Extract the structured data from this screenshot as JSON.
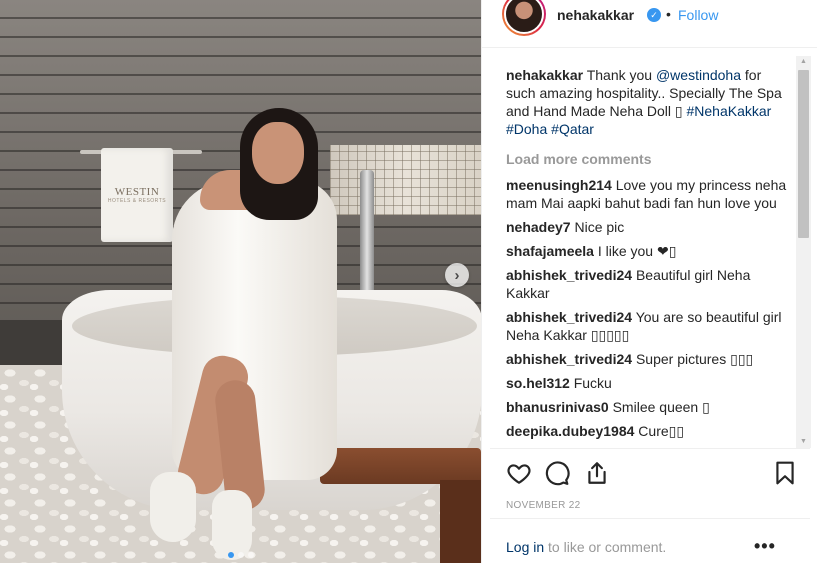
{
  "post": {
    "author": {
      "username": "nehakakkar",
      "verified_badge": "verified-icon",
      "separator": "•",
      "follow_label": "Follow"
    },
    "photo": {
      "towel_brand": "WESTIN",
      "towel_subtitle": "HOTELS & RESORTS",
      "carousel_count": 3,
      "carousel_active_index": 0
    },
    "caption": {
      "username": "nehakakkar",
      "text_1": " Thank you ",
      "mention": "@westindoha",
      "text_2": " for such amazing hospitality.. Specially The Spa and Hand Made Neha Doll ",
      "emoji": "▯",
      "hashtag_1": "#NehaKakkar",
      "hashtag_2": "#Doha",
      "hashtag_3": "#Qatar"
    },
    "load_more_label": "Load more comments",
    "comments": [
      {
        "user": "meenusingh214",
        "text": "Love you my princess neha mam Mai aapki bahut badi fan hun love you"
      },
      {
        "user": "nehadey7",
        "text": "Nice pic"
      },
      {
        "user": "shafajameela",
        "text": "I like you ❤▯"
      },
      {
        "user": "abhishek_trivedi24",
        "text": "Beautiful girl Neha Kakkar"
      },
      {
        "user": "abhishek_trivedi24",
        "text": "You are so beautiful girl Neha Kakkar ▯▯▯▯▯"
      },
      {
        "user": "abhishek_trivedi24",
        "text": "Super pictures ▯▯▯"
      },
      {
        "user": "so.hel312",
        "text": "Fucku"
      },
      {
        "user": "bhanusrinivas0",
        "text": "Smilee queen ▯"
      },
      {
        "user": "deepika.dubey1984",
        "text": "Cure▯▯"
      }
    ],
    "scrollbar": {
      "up_arrow": "▲",
      "down_arrow": "▼"
    },
    "actions": {
      "like_icon": "heart-icon",
      "comment_icon": "comment-bubble-icon",
      "share_icon": "share-icon",
      "save_icon": "bookmark-icon"
    },
    "date": "NOVEMBER 22",
    "footer": {
      "login_link": "Log in",
      "login_suffix": " to like or comment.",
      "more_label": "•••"
    },
    "colors": {
      "link_blue": "#3897f0",
      "hashtag_navy": "#003569",
      "muted_gray": "#999999",
      "text_dark": "#262626"
    }
  }
}
